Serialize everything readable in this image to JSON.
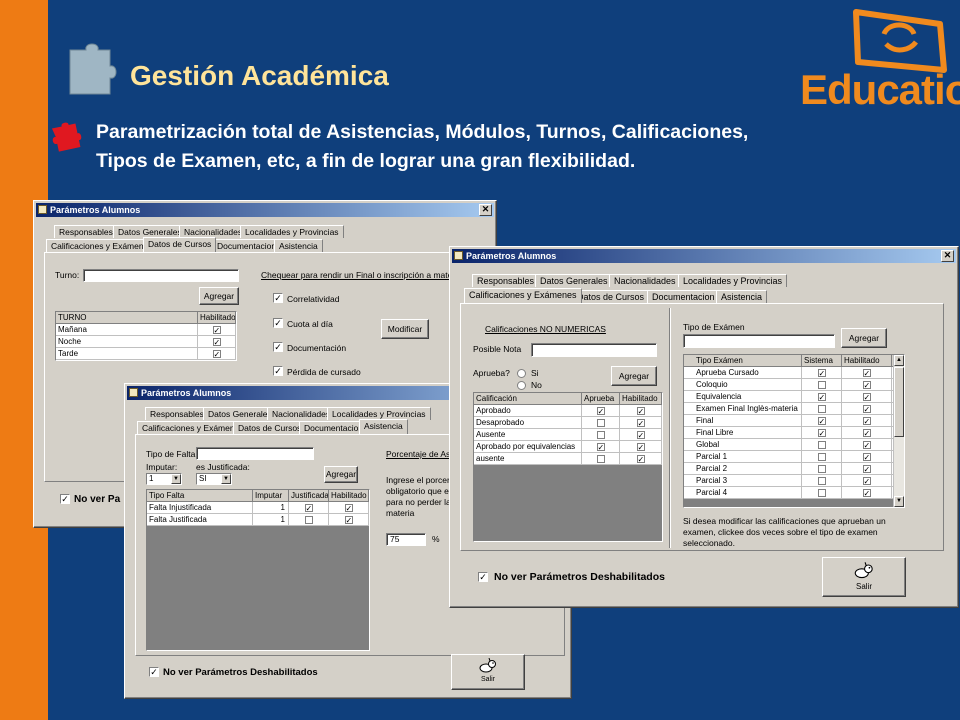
{
  "slide": {
    "title": "Gestión Académica",
    "description_line1": "Parametrización total de Asistencias, Módulos, Turnos, Calificaciones,",
    "description_line2": "Tipos de Examen, etc, a fin de lograr una gran flexibilidad.",
    "logo_text": "Educatio",
    "logo_mark": "®"
  },
  "colors": {
    "background": "#0f3f7c",
    "side_strip": "#ee7b14",
    "title": "#ffe49a",
    "logo": "#f08a1e",
    "bullet": "#e01820"
  },
  "win1": {
    "title": "Parámetros Alumnos",
    "close": "✕",
    "tabs_row1": [
      "Responsables",
      "Datos Generales",
      "Nacionalidades",
      "Localidades y Provincias"
    ],
    "tabs_row2": [
      "Calificaciones y Exámenes",
      "Datos de Cursos",
      "Documentacion",
      "Asistencia"
    ],
    "turno_label": "Turno:",
    "agregar": "Agregar",
    "grid_headers": [
      "TURNO",
      "Habilitado"
    ],
    "rows": [
      {
        "name": "Mañana",
        "hab": "✓"
      },
      {
        "name": "Noche",
        "hab": "✓"
      },
      {
        "name": "Tarde",
        "hab": "✓"
      }
    ],
    "chequear_label": "Chequear para rendir un Final o inscripción a materias:",
    "checks": [
      {
        "mark": "✓",
        "label": "Correlatividad"
      },
      {
        "mark": "✓",
        "label": "Cuota al día"
      },
      {
        "mark": "✓",
        "label": "Documentación"
      },
      {
        "mark": "✓",
        "label": "Pérdida de cursado"
      }
    ],
    "modificar": "Modificar",
    "no_ver": "No ver Pa",
    "no_ver_mark": "✓"
  },
  "win2": {
    "title": "Parámetros Alumnos",
    "close": "✕",
    "tabs_row1": [
      "Responsables",
      "Datos Generales",
      "Nacionalidades",
      "Localidades y Provincias"
    ],
    "tabs_row2": [
      "Calificaciones y Exámenes",
      "Datos de Cursos",
      "Documentacion",
      "Asistencia"
    ],
    "tipo_falta": "Tipo de Falta:",
    "imputar": "Imputar:",
    "es_justificada": "es Justificada:",
    "imputar_val": "1",
    "justif_val": "SI",
    "agregar": "Agregar",
    "grid_headers": [
      "Tipo Falta",
      "Imputar",
      "Justificada",
      "Habilitado"
    ],
    "rows": [
      {
        "tipo": "Falta Injustificada",
        "imp": "1",
        "just": "✓",
        "hab": "✓"
      },
      {
        "tipo": "Falta Justificada",
        "imp": "1",
        "just": "",
        "hab": "✓"
      }
    ],
    "porcentaje_label": "Porcentaje de Asist",
    "ingrese_line1": "Ingrese el porcenta",
    "ingrese_line2": "obligatorio que el al",
    "ingrese_line3": "para no perder la re",
    "ingrese_line4": "materia",
    "pct_value": "75",
    "pct_sign": "%",
    "no_ver": "No ver Parámetros Deshabilitados",
    "no_ver_mark": "✓",
    "salir": "Salir"
  },
  "win3": {
    "title": "Parámetros Alumnos",
    "close": "✕",
    "tabs_row1": [
      "Responsables",
      "Datos Generales",
      "Nacionalidades",
      "Localidades y Provincias"
    ],
    "tabs_row2": [
      "Calificaciones y Exámenes",
      "Datos de Cursos",
      "Documentacion",
      "Asistencia"
    ],
    "calif_no_num": "Calificaciones NO NUMERICAS",
    "posible_nota": "Posible Nota",
    "aprueba": "Aprueba?",
    "si": "Si",
    "no": "No",
    "agregar": "Agregar",
    "calif_headers": [
      "Calificación",
      "Aprueba",
      "Habilitado"
    ],
    "calif_rows": [
      {
        "name": "Aprobado",
        "ap": "✓",
        "hab": "✓"
      },
      {
        "name": "Desaprobado",
        "ap": "",
        "hab": "✓"
      },
      {
        "name": "Ausente",
        "ap": "",
        "hab": "✓"
      },
      {
        "name": "Aprobado por equivalencias",
        "ap": "✓",
        "hab": "✓"
      },
      {
        "name": "ausente",
        "ap": "",
        "hab": "✓"
      }
    ],
    "tipo_examen": "Tipo de Exámen",
    "agregar2": "Agregar",
    "exam_headers": [
      "Tipo Exámen",
      "Sistema",
      "Habilitado"
    ],
    "exam_rows": [
      {
        "name": "Aprueba Cursado",
        "sis": "✓",
        "hab": "✓"
      },
      {
        "name": "Coloquio",
        "sis": "",
        "hab": "✓"
      },
      {
        "name": "Equivalencia",
        "sis": "✓",
        "hab": "✓"
      },
      {
        "name": "Examen Final Inglès-materia",
        "sis": "",
        "hab": "✓"
      },
      {
        "name": "Final",
        "sis": "✓",
        "hab": "✓"
      },
      {
        "name": "Final Libre",
        "sis": "✓",
        "hab": "✓"
      },
      {
        "name": "Global",
        "sis": "",
        "hab": "✓"
      },
      {
        "name": "Parcial 1",
        "sis": "",
        "hab": "✓"
      },
      {
        "name": "Parcial 2",
        "sis": "",
        "hab": "✓"
      },
      {
        "name": "Parcial 3",
        "sis": "",
        "hab": "✓"
      },
      {
        "name": "Parcial 4",
        "sis": "",
        "hab": "✓"
      }
    ],
    "help_line1": "Si desea modificar las calificaciones que aprueban un",
    "help_line2": "examen, clickee dos veces sobre el tipo de examen",
    "help_line3": "seleccionado.",
    "no_ver": "No ver Parámetros Deshabilitados",
    "no_ver_mark": "✓",
    "salir": "Salir"
  }
}
